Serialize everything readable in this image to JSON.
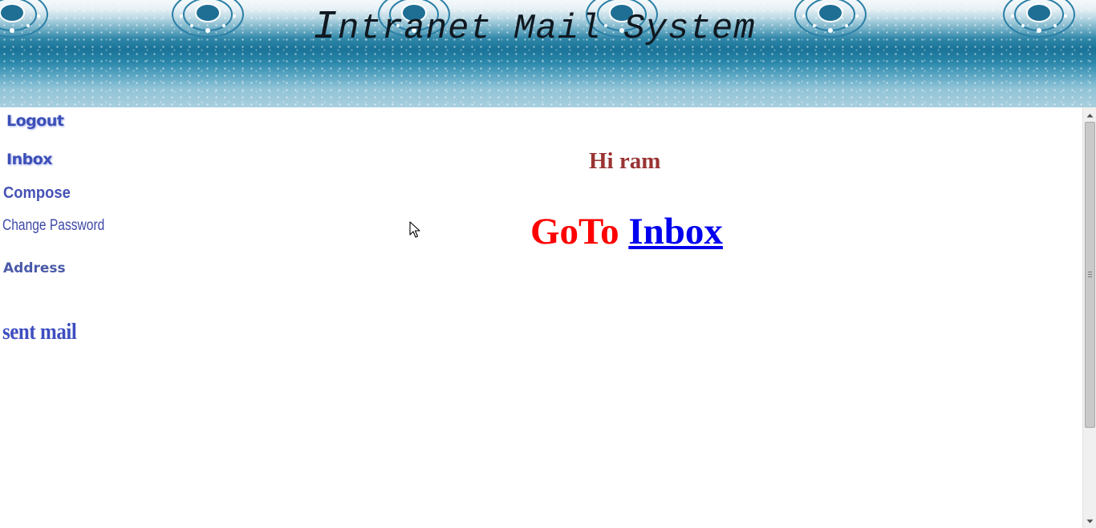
{
  "banner": {
    "title_first": "I",
    "title_rest": "ntranet Mail System",
    "ornament_icon": "floral-ornament-icon",
    "colors": {
      "sky_top": "#f4f8fa",
      "sky_deep": "#1a7398",
      "title": "#101820"
    }
  },
  "sidebar": {
    "logout": "Logout",
    "inbox": "Inbox",
    "compose": "Compose",
    "change_password": "Change Password",
    "address": "Address",
    "sent_mail": "sent mail",
    "color": "#3c4fb8"
  },
  "main": {
    "greeting": "Hi ram",
    "goto_label": "GoTo",
    "goto_link": "Inbox",
    "colors": {
      "greeting": "#993333",
      "goto_label": "#ff0000",
      "goto_link": "#0000ee"
    }
  },
  "icons": {
    "cursor": "mouse-pointer-icon",
    "scroll_up": "scroll-up-arrow-icon",
    "scroll_down": "scroll-down-arrow-icon"
  }
}
